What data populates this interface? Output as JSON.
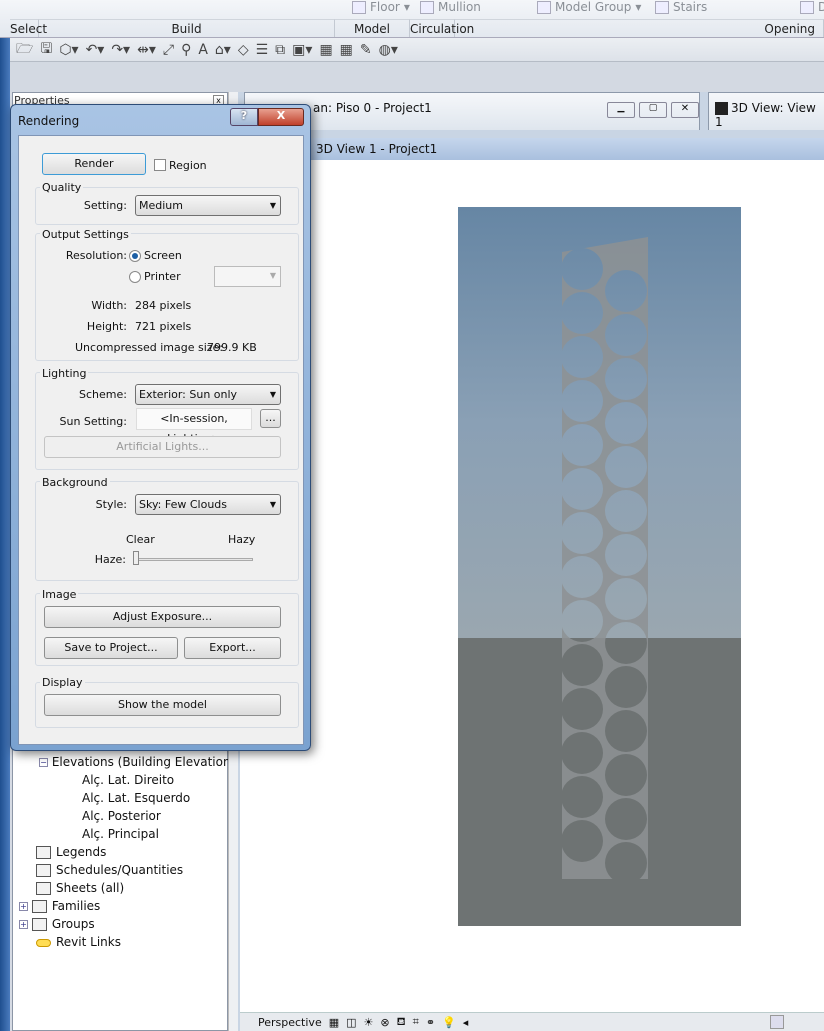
{
  "ribbon": {
    "top_items": [
      "Floor",
      "Mullion",
      "Model Group",
      "Stairs",
      "D"
    ],
    "panels": [
      "Select",
      "Build",
      "Model",
      "Circulation",
      "Opening"
    ]
  },
  "properties": {
    "title": "Properties"
  },
  "browser": {
    "items": [
      "Elevations (Building Elevation)",
      "Alç. Lat. Direito",
      "Alç. Lat. Esquerdo",
      "Alç. Posterior",
      "Alç. Principal",
      "Legends",
      "Schedules/Quantities",
      "Sheets (all)",
      "Families",
      "Groups",
      "Revit Links"
    ]
  },
  "views": {
    "floorplan_tab": "an: Piso 0 - Project1",
    "view3d_tab": "3D View: View 1",
    "active_title": "3D View 1 - Project1"
  },
  "status": {
    "view_mode": "Perspective"
  },
  "dialog": {
    "title": "Rendering",
    "help": "?",
    "close": "X",
    "render_button": "Render",
    "region_label": "Region",
    "region_checked": false,
    "quality": {
      "title": "Quality",
      "setting_label": "Setting:",
      "setting_value": "Medium"
    },
    "output": {
      "title": "Output Settings",
      "resolution_label": "Resolution:",
      "screen": "Screen",
      "printer": "Printer",
      "selected": "Screen",
      "width_label": "Width:",
      "width_value": "284 pixels",
      "height_label": "Height:",
      "height_value": "721 pixels",
      "size_label": "Uncompressed image size:",
      "size_value": "799.9 KB"
    },
    "lighting": {
      "title": "Lighting",
      "scheme_label": "Scheme:",
      "scheme_value": "Exterior: Sun only",
      "sun_label": "Sun Setting:",
      "sun_value": "<In-session, Lighting>",
      "sun_browse": "...",
      "artificial": "Artificial Lights..."
    },
    "background": {
      "title": "Background",
      "style_label": "Style:",
      "style_value": "Sky: Few Clouds",
      "clear": "Clear",
      "hazy": "Hazy",
      "haze_label": "Haze:",
      "haze_value": 0
    },
    "image": {
      "title": "Image",
      "adjust": "Adjust Exposure...",
      "save": "Save to Project...",
      "export": "Export..."
    },
    "display": {
      "title": "Display",
      "show_model": "Show the model"
    }
  }
}
